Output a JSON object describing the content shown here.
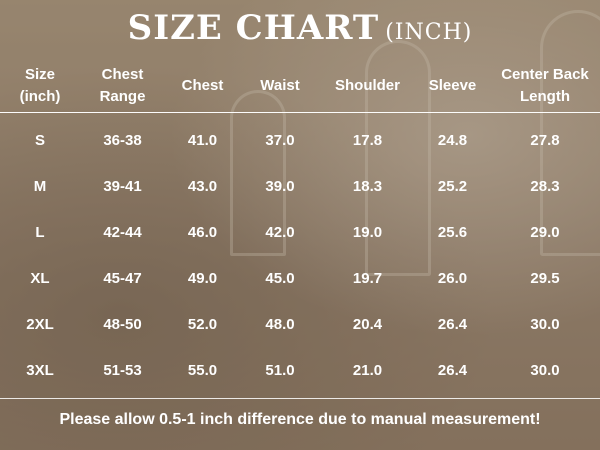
{
  "title": {
    "main": "SIZE CHART",
    "sub": "(INCH)"
  },
  "columns": [
    [
      "Size",
      "(inch)"
    ],
    [
      "Chest",
      "Range"
    ],
    [
      "Chest"
    ],
    [
      "Waist"
    ],
    [
      "Shoulder"
    ],
    [
      "Sleeve"
    ],
    [
      "Center Back",
      "Length"
    ]
  ],
  "rows": [
    [
      "S",
      "36-38",
      "41.0",
      "37.0",
      "17.8",
      "24.8",
      "27.8"
    ],
    [
      "M",
      "39-41",
      "43.0",
      "39.0",
      "18.3",
      "25.2",
      "28.3"
    ],
    [
      "L",
      "42-44",
      "46.0",
      "42.0",
      "19.0",
      "25.6",
      "29.0"
    ],
    [
      "XL",
      "45-47",
      "49.0",
      "45.0",
      "19.7",
      "26.0",
      "29.5"
    ],
    [
      "2XL",
      "48-50",
      "52.0",
      "48.0",
      "20.4",
      "26.4",
      "30.0"
    ],
    [
      "3XL",
      "51-53",
      "55.0",
      "51.0",
      "21.0",
      "26.4",
      "30.0"
    ]
  ],
  "footer": "Please allow 0.5-1 inch difference due to manual measurement!"
}
